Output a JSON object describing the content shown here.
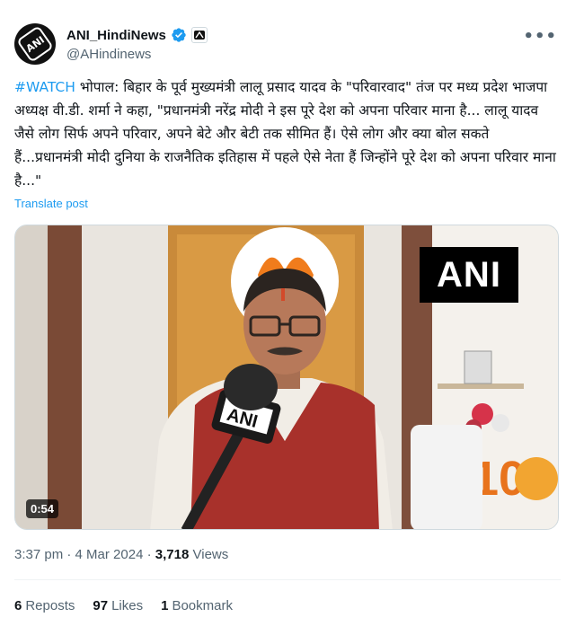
{
  "account": {
    "display_name": "ANI_HindiNews",
    "handle": "@AHindinews",
    "avatar_text": "ANI",
    "verified_icon": "verified-badge-icon",
    "affiliate_icon": "affiliate-logo-icon"
  },
  "tweet": {
    "hashtag": "#WATCH",
    "body": " भोपाल: बिहार के पूर्व मुख्यमंत्री लालू प्रसाद यादव के \"परिवारवाद\" तंज पर मध्य प्रदेश भाजपा अध्यक्ष वी.डी. शर्मा ने कहा, \"प्रधानमंत्री नरेंद्र मोदी ने इस पूरे देश को अपना परिवार माना है... लालू यादव जैसे लोग सिर्फ अपने परिवार, अपने बेटे और बेटी तक सीमित हैं। ऐसे लोग और क्या बोल सकते हैं...प्रधानमंत्री मोदी दुनिया के राजनैतिक इतिहास में पहले ऐसे नेता हैं जिन्होंने पूरे देश को अपना परिवार माना है...\"",
    "translate_label": "Translate post"
  },
  "media": {
    "duration": "0:54",
    "watermark": "ANI",
    "mic_label": "ANI"
  },
  "meta": {
    "time": "3:37 pm",
    "separator": "·",
    "date": "4 Mar 2024",
    "views_count": "3,718",
    "views_label": "Views"
  },
  "stats": {
    "reposts_count": "6",
    "reposts_label": "Reposts",
    "likes_count": "97",
    "likes_label": "Likes",
    "bookmarks_count": "1",
    "bookmarks_label": "Bookmark"
  },
  "colors": {
    "accent": "#1d9bf0",
    "muted": "#536471",
    "text": "#0f1419"
  }
}
